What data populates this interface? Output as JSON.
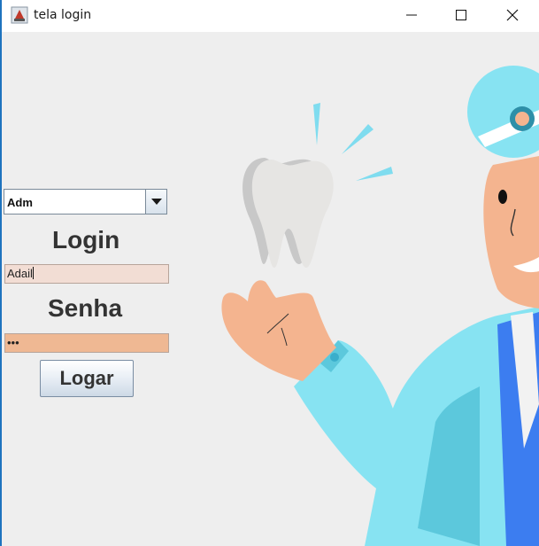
{
  "window": {
    "title": "tela login",
    "app_icon": "java-cup-icon",
    "controls": [
      "minimize-icon",
      "maximize-icon",
      "close-icon"
    ]
  },
  "form": {
    "role_select": {
      "selected": "Adm"
    },
    "login_label": "Login",
    "login_value": "Adail",
    "senha_label": "Senha",
    "senha_masked": "•••",
    "submit_label": "Logar"
  },
  "colors": {
    "background": "#eeeeee",
    "login_field": "#f2ddd4",
    "senha_field": "#efb893",
    "coat": "#87e3f2",
    "skin": "#f4b48f",
    "tooth": "#e6e5e3"
  },
  "illustration": "dentist-holding-tooth"
}
